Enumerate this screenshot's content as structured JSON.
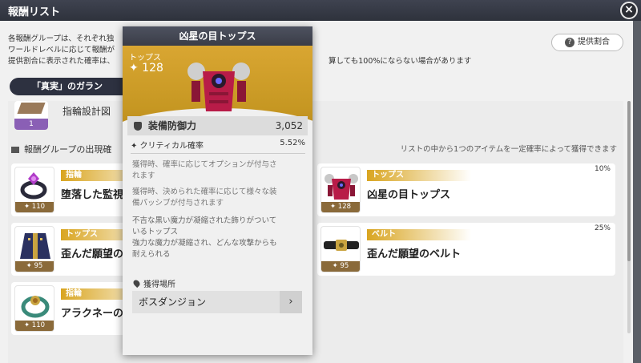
{
  "window": {
    "title": "報酬リスト",
    "close_icon": "×"
  },
  "description": {
    "line1": "各報酬グループは、それぞれ独",
    "line2": "ワールドレベルに応じて報酬が",
    "line3": "提供割合に表示された確率は、",
    "line3_right": "算しても100%にならない場合があります"
  },
  "rate_button": {
    "label": "提供割合",
    "icon": "?"
  },
  "tab": {
    "label": "「真実」のガラン"
  },
  "top_item": {
    "name": "指輪設計図",
    "count": "1"
  },
  "section": {
    "title": "報酬グループの出現確",
    "note": "リストの中から1つのアイテムを一定確率によって獲得できます"
  },
  "items": [
    {
      "category": "指輪",
      "name": "堕落した監視",
      "level": "✦ 110",
      "rate": ""
    },
    {
      "category": "トップス",
      "name": "凶星の目トップス",
      "level": "✦ 128",
      "rate": "10%"
    },
    {
      "category": "トップス",
      "name": "歪んだ願望の",
      "level": "✦ 95",
      "rate": ""
    },
    {
      "category": "ベルト",
      "name": "歪んだ願望のベルト",
      "level": "✦ 95",
      "rate": "25%"
    },
    {
      "category": "指輪",
      "name": "アラクネーの",
      "level": "✦ 110",
      "rate": ""
    }
  ],
  "tooltip": {
    "title": "凶星の目トップス",
    "type": "トップス",
    "level": "✦ 128",
    "main_stat": {
      "label": "装備防御力",
      "value": "3,052"
    },
    "sub_stat": {
      "label": "✦ クリティカル確率",
      "value": "5.52%"
    },
    "text1a": "獲得時、確率に応じてオプションが付与さ",
    "text1b": "れます",
    "text2a": "獲得時、決められた確率に応じて様々な装",
    "text2b": "備パッシブが付与されます",
    "text3a": "不吉な黒い魔力が凝縮された飾りがついて",
    "text3b": "いるトップス",
    "text3c": "強力な魔力が凝縮され、どんな攻撃からも",
    "text3d": "耐えられる",
    "acquire_label": "獲得場所",
    "acquire_button": "ボスダンジョン",
    "arrow": "›"
  }
}
